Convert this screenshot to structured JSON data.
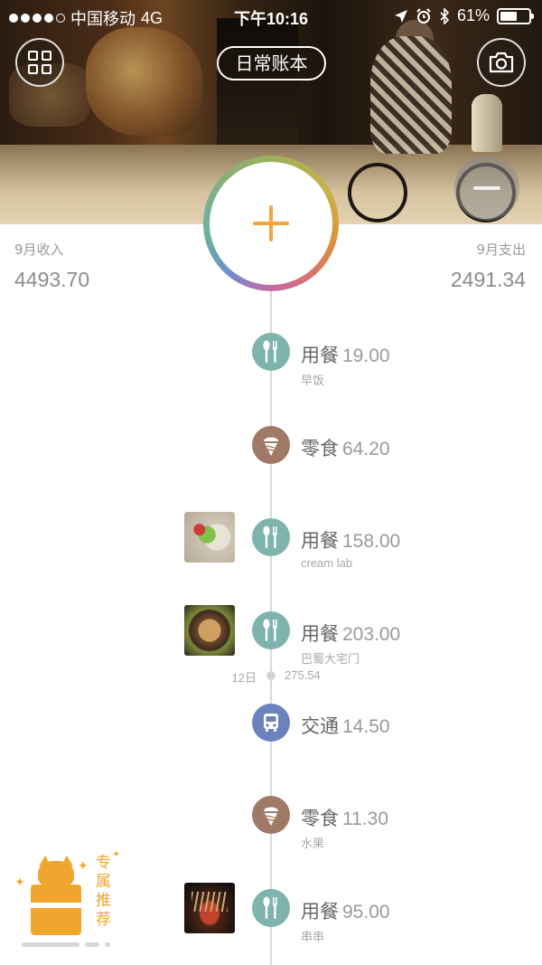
{
  "status_bar": {
    "carrier": "中国移动",
    "network": "4G",
    "time": "下午10:16",
    "battery": "61%",
    "battery_level": 0.61
  },
  "header": {
    "title": "日常账本",
    "left_icon": "grid-icon",
    "right_icon": "camera-icon"
  },
  "summary": {
    "income_label": "9月收入",
    "income_value": "4493.70",
    "expense_label": "9月支出",
    "expense_value": "2491.34"
  },
  "add_button": {
    "icon": "plus-icon",
    "ring_colors": [
      "#9ab05a",
      "#d99a3a",
      "#c867a8",
      "#6c8fc9",
      "#6fb0a2"
    ]
  },
  "entries": [
    {
      "category": "用餐",
      "amount": "19.00",
      "note": "早饭",
      "icon": "fork-spoon-icon",
      "color": "#7fb3ae"
    },
    {
      "category": "零食",
      "amount": "64.20",
      "note": "",
      "icon": "ice-cream-icon",
      "color": "#a07a66"
    },
    {
      "category": "用餐",
      "amount": "158.00",
      "note": "cream lab",
      "icon": "fork-spoon-icon",
      "color": "#7fb3ae",
      "has_photo": true
    },
    {
      "category": "用餐",
      "amount": "203.00",
      "note": "巴蜀大宅门",
      "icon": "fork-spoon-icon",
      "color": "#7fb3ae",
      "has_photo": true
    },
    {
      "category": "交通",
      "amount": "14.50",
      "note": "",
      "icon": "bus-icon",
      "color": "#6b82bd"
    },
    {
      "category": "零食",
      "amount": "11.30",
      "note": "水果",
      "icon": "ice-cream-icon",
      "color": "#a07a66"
    },
    {
      "category": "用餐",
      "amount": "95.00",
      "note": "串串",
      "icon": "fork-spoon-icon",
      "color": "#7fb3ae",
      "has_photo": true
    }
  ],
  "day_marker": {
    "day": "12日",
    "total": "275.54"
  },
  "promo": {
    "text": "专属推荐",
    "icon": "fox-gift-icon",
    "accent": "#f2a52e"
  }
}
